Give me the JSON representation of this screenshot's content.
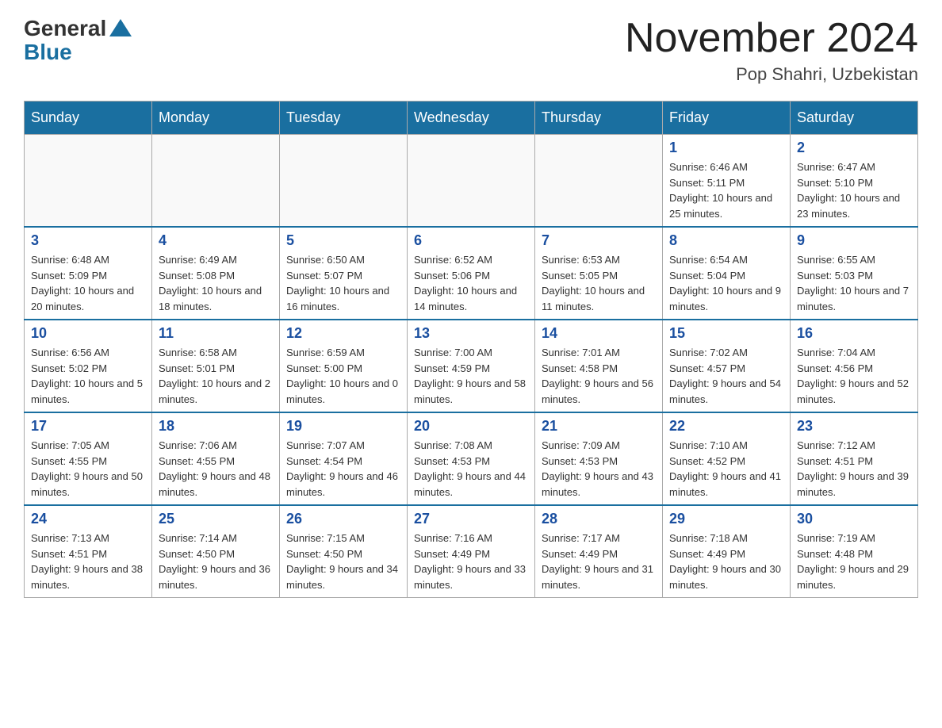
{
  "header": {
    "logo_general": "General",
    "logo_blue": "Blue",
    "month_title": "November 2024",
    "location": "Pop Shahri, Uzbekistan"
  },
  "days_of_week": [
    "Sunday",
    "Monday",
    "Tuesday",
    "Wednesday",
    "Thursday",
    "Friday",
    "Saturday"
  ],
  "weeks": [
    [
      {
        "day": "",
        "info": ""
      },
      {
        "day": "",
        "info": ""
      },
      {
        "day": "",
        "info": ""
      },
      {
        "day": "",
        "info": ""
      },
      {
        "day": "",
        "info": ""
      },
      {
        "day": "1",
        "info": "Sunrise: 6:46 AM\nSunset: 5:11 PM\nDaylight: 10 hours and 25 minutes."
      },
      {
        "day": "2",
        "info": "Sunrise: 6:47 AM\nSunset: 5:10 PM\nDaylight: 10 hours and 23 minutes."
      }
    ],
    [
      {
        "day": "3",
        "info": "Sunrise: 6:48 AM\nSunset: 5:09 PM\nDaylight: 10 hours and 20 minutes."
      },
      {
        "day": "4",
        "info": "Sunrise: 6:49 AM\nSunset: 5:08 PM\nDaylight: 10 hours and 18 minutes."
      },
      {
        "day": "5",
        "info": "Sunrise: 6:50 AM\nSunset: 5:07 PM\nDaylight: 10 hours and 16 minutes."
      },
      {
        "day": "6",
        "info": "Sunrise: 6:52 AM\nSunset: 5:06 PM\nDaylight: 10 hours and 14 minutes."
      },
      {
        "day": "7",
        "info": "Sunrise: 6:53 AM\nSunset: 5:05 PM\nDaylight: 10 hours and 11 minutes."
      },
      {
        "day": "8",
        "info": "Sunrise: 6:54 AM\nSunset: 5:04 PM\nDaylight: 10 hours and 9 minutes."
      },
      {
        "day": "9",
        "info": "Sunrise: 6:55 AM\nSunset: 5:03 PM\nDaylight: 10 hours and 7 minutes."
      }
    ],
    [
      {
        "day": "10",
        "info": "Sunrise: 6:56 AM\nSunset: 5:02 PM\nDaylight: 10 hours and 5 minutes."
      },
      {
        "day": "11",
        "info": "Sunrise: 6:58 AM\nSunset: 5:01 PM\nDaylight: 10 hours and 2 minutes."
      },
      {
        "day": "12",
        "info": "Sunrise: 6:59 AM\nSunset: 5:00 PM\nDaylight: 10 hours and 0 minutes."
      },
      {
        "day": "13",
        "info": "Sunrise: 7:00 AM\nSunset: 4:59 PM\nDaylight: 9 hours and 58 minutes."
      },
      {
        "day": "14",
        "info": "Sunrise: 7:01 AM\nSunset: 4:58 PM\nDaylight: 9 hours and 56 minutes."
      },
      {
        "day": "15",
        "info": "Sunrise: 7:02 AM\nSunset: 4:57 PM\nDaylight: 9 hours and 54 minutes."
      },
      {
        "day": "16",
        "info": "Sunrise: 7:04 AM\nSunset: 4:56 PM\nDaylight: 9 hours and 52 minutes."
      }
    ],
    [
      {
        "day": "17",
        "info": "Sunrise: 7:05 AM\nSunset: 4:55 PM\nDaylight: 9 hours and 50 minutes."
      },
      {
        "day": "18",
        "info": "Sunrise: 7:06 AM\nSunset: 4:55 PM\nDaylight: 9 hours and 48 minutes."
      },
      {
        "day": "19",
        "info": "Sunrise: 7:07 AM\nSunset: 4:54 PM\nDaylight: 9 hours and 46 minutes."
      },
      {
        "day": "20",
        "info": "Sunrise: 7:08 AM\nSunset: 4:53 PM\nDaylight: 9 hours and 44 minutes."
      },
      {
        "day": "21",
        "info": "Sunrise: 7:09 AM\nSunset: 4:53 PM\nDaylight: 9 hours and 43 minutes."
      },
      {
        "day": "22",
        "info": "Sunrise: 7:10 AM\nSunset: 4:52 PM\nDaylight: 9 hours and 41 minutes."
      },
      {
        "day": "23",
        "info": "Sunrise: 7:12 AM\nSunset: 4:51 PM\nDaylight: 9 hours and 39 minutes."
      }
    ],
    [
      {
        "day": "24",
        "info": "Sunrise: 7:13 AM\nSunset: 4:51 PM\nDaylight: 9 hours and 38 minutes."
      },
      {
        "day": "25",
        "info": "Sunrise: 7:14 AM\nSunset: 4:50 PM\nDaylight: 9 hours and 36 minutes."
      },
      {
        "day": "26",
        "info": "Sunrise: 7:15 AM\nSunset: 4:50 PM\nDaylight: 9 hours and 34 minutes."
      },
      {
        "day": "27",
        "info": "Sunrise: 7:16 AM\nSunset: 4:49 PM\nDaylight: 9 hours and 33 minutes."
      },
      {
        "day": "28",
        "info": "Sunrise: 7:17 AM\nSunset: 4:49 PM\nDaylight: 9 hours and 31 minutes."
      },
      {
        "day": "29",
        "info": "Sunrise: 7:18 AM\nSunset: 4:49 PM\nDaylight: 9 hours and 30 minutes."
      },
      {
        "day": "30",
        "info": "Sunrise: 7:19 AM\nSunset: 4:48 PM\nDaylight: 9 hours and 29 minutes."
      }
    ]
  ]
}
